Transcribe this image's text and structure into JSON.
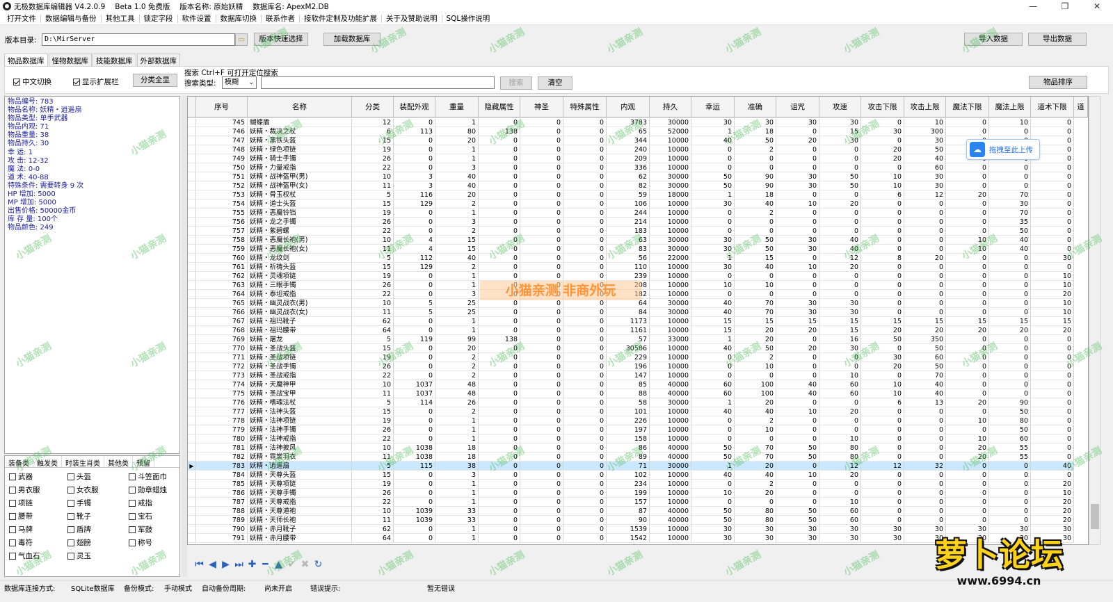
{
  "title": {
    "app": "无极数据库编辑器 V4.2.0.9",
    "beta": "Beta 1.0 免费版",
    "version": "版本名称: 原始妖精",
    "dbname": "数据库名: ApexM2.DB"
  },
  "window_buttons": {
    "min": "—",
    "max": "❐",
    "close": "✕"
  },
  "menu": [
    "打开文件",
    "数据编辑与备份",
    "其他工具",
    "锁定字段",
    "软件设置",
    "数据库切换",
    "联系作者",
    "接软件定制及功能扩展",
    "关于及赞助说明",
    "SQL操作说明"
  ],
  "toolbar": {
    "dir_label": "版本目录:",
    "dir_value": "D:\\MirServer",
    "quick_select": "版本快速选择",
    "load_db": "加载数据库",
    "import": "导入数据",
    "export": "导出数据"
  },
  "tabs": [
    {
      "label": "物品数据库",
      "active": true
    },
    {
      "label": "怪物数据库",
      "active": false
    },
    {
      "label": "技能数据库",
      "active": false
    },
    {
      "label": "外部数据库",
      "active": false
    }
  ],
  "filter": {
    "chinese_toggle": "中文切换",
    "show_ext": "显示扩展栏",
    "all_cats": "分类全显",
    "search_title": "搜索  Ctrl+F 可打开定位搜索",
    "search_type_label": "搜索类型:",
    "search_type": "模糊",
    "search_btn": "搜索",
    "clear_btn": "清空",
    "sort_btn": "物品排序"
  },
  "info": [
    "物品编号: 783",
    "物品名称: 妖精・逍遥扇",
    "物品类型: 单手武器",
    "物品内观: 71",
    "物品重量: 38",
    "物品持久: 30",
    "幸    运: 1",
    "攻    击: 12-32",
    "魔    法: 0-0",
    "道    术: 40-88",
    "特殊条件: 需要转身 9 次",
    "HP  增加: 5000",
    "MP  增加: 5000",
    "出售价格: 50000金币",
    "库 存 量: 100个",
    "物品颜色: 249"
  ],
  "cat_tabs": [
    "装备类",
    "触发类",
    "时装生肖类",
    "其他类",
    "预留"
  ],
  "categories": [
    "武器",
    "头盔",
    "斗笠面巾",
    "男衣服",
    "女衣服",
    "勋章蜡烛",
    "项链",
    "手镯",
    "戒指",
    "腰带",
    "靴子",
    "宝石",
    "马牌",
    "盾牌",
    "军鼓",
    "毒符",
    "翅膀",
    "称号",
    "气血石",
    "灵玉"
  ],
  "columns": [
    "序号",
    "名称",
    "分类",
    "装配外观",
    "重量",
    "隐藏属性",
    "神圣",
    "特殊属性",
    "内观",
    "持久",
    "幸运",
    "准确",
    "诅咒",
    "攻速",
    "攻击下限",
    "攻击上限",
    "魔法下限",
    "魔法上限",
    "道术下限",
    "道"
  ],
  "rows": [
    [
      "745",
      "蝴蝶盾",
      "12",
      "0",
      "1",
      "0",
      "0",
      "0",
      "3783",
      "30000",
      "30",
      "30",
      "30",
      "30",
      "0",
      "10",
      "0",
      "10",
      "0"
    ],
    [
      "746",
      "妖精・裁决之杖",
      "6",
      "113",
      "80",
      "138",
      "0",
      "0",
      "65",
      "52000",
      "1",
      "18",
      "0",
      "15",
      "30",
      "300",
      "0",
      "0",
      "0"
    ],
    [
      "747",
      "妖精・黑铁头盔",
      "15",
      "0",
      "20",
      "0",
      "0",
      "0",
      "344",
      "10000",
      "40",
      "50",
      "20",
      "30",
      "0",
      "30",
      "0",
      "0",
      "0"
    ],
    [
      "748",
      "妖精・绿色项链",
      "19",
      "0",
      "1",
      "0",
      "0",
      "0",
      "240",
      "10000",
      "0",
      "2",
      "0",
      "0",
      "20",
      "50",
      "0",
      "0",
      "0"
    ],
    [
      "749",
      "妖精・骑士手镯",
      "26",
      "0",
      "1",
      "0",
      "0",
      "0",
      "209",
      "10000",
      "0",
      "0",
      "0",
      "0",
      "20",
      "40",
      "0",
      "0",
      "0"
    ],
    [
      "750",
      "妖精・力量戒指",
      "22",
      "0",
      "3",
      "0",
      "0",
      "0",
      "336",
      "10000",
      "0",
      "0",
      "0",
      "0",
      "0",
      "60",
      "0",
      "0",
      "0"
    ],
    [
      "751",
      "妖精・战神盔甲(男)",
      "10",
      "3",
      "40",
      "0",
      "0",
      "0",
      "62",
      "30000",
      "50",
      "90",
      "30",
      "50",
      "10",
      "30",
      "0",
      "0",
      "0"
    ],
    [
      "752",
      "妖精・战神盔甲(女)",
      "11",
      "3",
      "40",
      "0",
      "0",
      "0",
      "82",
      "30000",
      "50",
      "90",
      "30",
      "50",
      "10",
      "30",
      "0",
      "0",
      "0"
    ],
    [
      "753",
      "妖精・骨玉权杖",
      "5",
      "116",
      "20",
      "0",
      "0",
      "0",
      "59",
      "18000",
      "1",
      "18",
      "0",
      "0",
      "6",
      "12",
      "20",
      "70",
      "0"
    ],
    [
      "754",
      "妖精・道士头盔",
      "15",
      "129",
      "2",
      "0",
      "0",
      "0",
      "106",
      "10000",
      "30",
      "40",
      "10",
      "20",
      "0",
      "0",
      "0",
      "30",
      "0"
    ],
    [
      "755",
      "妖精・恶魔铃铛",
      "19",
      "0",
      "1",
      "0",
      "0",
      "0",
      "244",
      "10000",
      "0",
      "2",
      "0",
      "0",
      "0",
      "0",
      "0",
      "70",
      "0"
    ],
    [
      "756",
      "妖精・龙之手镯",
      "26",
      "0",
      "3",
      "0",
      "0",
      "0",
      "214",
      "10000",
      "0",
      "0",
      "0",
      "0",
      "0",
      "0",
      "0",
      "35",
      "0"
    ],
    [
      "757",
      "妖精・紫碧螺",
      "22",
      "0",
      "2",
      "0",
      "0",
      "0",
      "183",
      "10000",
      "0",
      "0",
      "0",
      "0",
      "0",
      "0",
      "0",
      "50",
      "0"
    ],
    [
      "758",
      "妖精・恶魔长袍(男)",
      "10",
      "4",
      "15",
      "0",
      "0",
      "0",
      "63",
      "30000",
      "30",
      "50",
      "30",
      "40",
      "0",
      "0",
      "10",
      "40",
      "0"
    ],
    [
      "759",
      "妖精・恶魔长袍(女)",
      "11",
      "4",
      "15",
      "0",
      "0",
      "0",
      "83",
      "30000",
      "30",
      "50",
      "30",
      "40",
      "0",
      "0",
      "10",
      "40",
      "0"
    ],
    [
      "760",
      "妖精・龙纹剑",
      "5",
      "112",
      "40",
      "0",
      "0",
      "0",
      "56",
      "22000",
      "1",
      "15",
      "0",
      "12",
      "8",
      "20",
      "0",
      "0",
      "30"
    ],
    [
      "761",
      "妖精・祈祷头盔",
      "15",
      "129",
      "2",
      "0",
      "0",
      "0",
      "110",
      "10000",
      "30",
      "40",
      "10",
      "20",
      "0",
      "0",
      "0",
      "0",
      "0"
    ],
    [
      "762",
      "妖精・灵魂项链",
      "19",
      "0",
      "1",
      "0",
      "0",
      "0",
      "239",
      "10000",
      "0",
      "0",
      "0",
      "0",
      "0",
      "0",
      "0",
      "0",
      "10"
    ],
    [
      "763",
      "妖精・三眼手镯",
      "26",
      "0",
      "1",
      "0",
      "0",
      "0",
      "208",
      "10000",
      "10",
      "10",
      "0",
      "0",
      "0",
      "0",
      "0",
      "0",
      "10"
    ],
    [
      "764",
      "妖精・泰坦戒指",
      "22",
      "0",
      "3",
      "0",
      "0",
      "0",
      "182",
      "10000",
      "0",
      "0",
      "0",
      "0",
      "0",
      "0",
      "0",
      "0",
      "20"
    ],
    [
      "765",
      "妖精・幽灵战衣(男)",
      "10",
      "5",
      "25",
      "0",
      "0",
      "0",
      "64",
      "30000",
      "40",
      "70",
      "30",
      "30",
      "0",
      "0",
      "0",
      "0",
      "10"
    ],
    [
      "766",
      "妖精・幽灵战衣(女)",
      "11",
      "5",
      "25",
      "0",
      "0",
      "0",
      "84",
      "30000",
      "40",
      "70",
      "30",
      "30",
      "0",
      "0",
      "0",
      "0",
      "10"
    ],
    [
      "767",
      "妖精・祖玛靴子",
      "62",
      "0",
      "1",
      "0",
      "0",
      "0",
      "1173",
      "10000",
      "15",
      "15",
      "15",
      "15",
      "15",
      "15",
      "15",
      "15",
      "15"
    ],
    [
      "768",
      "妖精・祖玛腰带",
      "64",
      "0",
      "1",
      "0",
      "0",
      "0",
      "1161",
      "10000",
      "15",
      "20",
      "20",
      "15",
      "20",
      "20",
      "20",
      "20",
      "20"
    ],
    [
      "769",
      "妖精・屠龙",
      "5",
      "119",
      "99",
      "138",
      "0",
      "0",
      "57",
      "33000",
      "1",
      "20",
      "0",
      "16",
      "50",
      "350",
      "0",
      "0",
      "0"
    ],
    [
      "770",
      "妖精・圣战头盔",
      "15",
      "0",
      "20",
      "0",
      "0",
      "0",
      "30586",
      "10000",
      "40",
      "50",
      "20",
      "30",
      "0",
      "50",
      "0",
      "0",
      "0"
    ],
    [
      "771",
      "妖精・圣战项链",
      "19",
      "0",
      "2",
      "0",
      "0",
      "0",
      "229",
      "10000",
      "0",
      "2",
      "0",
      "0",
      "30",
      "60",
      "0",
      "0",
      "0"
    ],
    [
      "772",
      "妖精・圣战手镯",
      "26",
      "0",
      "2",
      "0",
      "0",
      "0",
      "196",
      "10000",
      "0",
      "10",
      "0",
      "0",
      "20",
      "50",
      "0",
      "0",
      "0"
    ],
    [
      "773",
      "妖精・圣战戒指",
      "22",
      "0",
      "2",
      "0",
      "0",
      "0",
      "147",
      "10000",
      "0",
      "0",
      "0",
      "10",
      "0",
      "70",
      "0",
      "0",
      "0"
    ],
    [
      "774",
      "妖精・天魔神甲",
      "10",
      "1037",
      "48",
      "0",
      "0",
      "0",
      "85",
      "40000",
      "60",
      "100",
      "40",
      "60",
      "10",
      "40",
      "0",
      "0",
      "0"
    ],
    [
      "775",
      "妖精・圣战宝甲",
      "11",
      "1037",
      "48",
      "0",
      "0",
      "0",
      "88",
      "40000",
      "60",
      "100",
      "40",
      "60",
      "10",
      "40",
      "0",
      "0",
      "0"
    ],
    [
      "776",
      "妖精・嗜魂法杖",
      "5",
      "114",
      "26",
      "0",
      "0",
      "0",
      "58",
      "30000",
      "1",
      "20",
      "0",
      "0",
      "6",
      "13",
      "20",
      "90",
      "0"
    ],
    [
      "777",
      "妖精・法神头盔",
      "15",
      "0",
      "2",
      "0",
      "0",
      "0",
      "101",
      "10000",
      "40",
      "40",
      "10",
      "20",
      "0",
      "0",
      "0",
      "50",
      "0"
    ],
    [
      "778",
      "妖精・法神项链",
      "19",
      "0",
      "1",
      "0",
      "0",
      "0",
      "226",
      "10000",
      "0",
      "2",
      "0",
      "0",
      "0",
      "0",
      "10",
      "80",
      "0"
    ],
    [
      "779",
      "妖精・法神手镯",
      "26",
      "0",
      "1",
      "0",
      "0",
      "0",
      "197",
      "10000",
      "0",
      "10",
      "0",
      "0",
      "0",
      "0",
      "0",
      "50",
      "0"
    ],
    [
      "780",
      "妖精・法神戒指",
      "22",
      "0",
      "1",
      "0",
      "0",
      "0",
      "158",
      "10000",
      "0",
      "0",
      "0",
      "10",
      "0",
      "0",
      "10",
      "60",
      "0"
    ],
    [
      "781",
      "妖精・法神披风",
      "10",
      "1038",
      "18",
      "0",
      "0",
      "0",
      "86",
      "40000",
      "50",
      "70",
      "50",
      "80",
      "0",
      "0",
      "20",
      "55",
      "0"
    ],
    [
      "782",
      "妖精・霓裳羽衣",
      "11",
      "1038",
      "18",
      "0",
      "0",
      "0",
      "89",
      "40000",
      "50",
      "70",
      "50",
      "80",
      "0",
      "0",
      "20",
      "55",
      "0"
    ],
    [
      "783",
      "妖精・逍遥扇",
      "5",
      "115",
      "38",
      "0",
      "0",
      "0",
      "71",
      "30000",
      "1",
      "20",
      "0",
      "12",
      "12",
      "32",
      "0",
      "0",
      "40"
    ],
    [
      "784",
      "妖精・天尊头盔",
      "15",
      "0",
      "3",
      "0",
      "0",
      "0",
      "102",
      "10000",
      "40",
      "40",
      "10",
      "20",
      "0",
      "0",
      "0",
      "0",
      "0"
    ],
    [
      "785",
      "妖精・天尊项链",
      "19",
      "0",
      "1",
      "0",
      "0",
      "0",
      "234",
      "10000",
      "0",
      "2",
      "0",
      "0",
      "0",
      "0",
      "0",
      "0",
      "20"
    ],
    [
      "786",
      "妖精・天尊手镯",
      "26",
      "0",
      "1",
      "0",
      "0",
      "0",
      "199",
      "10000",
      "10",
      "20",
      "0",
      "0",
      "0",
      "0",
      "0",
      "0",
      "10"
    ],
    [
      "787",
      "妖精・天尊戒指",
      "22",
      "0",
      "1",
      "0",
      "0",
      "0",
      "157",
      "10000",
      "0",
      "0",
      "0",
      "10",
      "0",
      "0",
      "0",
      "0",
      "20"
    ],
    [
      "788",
      "妖精・天尊道袍",
      "10",
      "1039",
      "33",
      "0",
      "0",
      "0",
      "87",
      "40000",
      "50",
      "80",
      "50",
      "60",
      "0",
      "0",
      "0",
      "0",
      "20"
    ],
    [
      "789",
      "妖精・天师长袍",
      "11",
      "1039",
      "33",
      "0",
      "0",
      "0",
      "90",
      "40000",
      "50",
      "80",
      "50",
      "60",
      "0",
      "0",
      "0",
      "0",
      "20"
    ],
    [
      "790",
      "妖精・赤月靴子",
      "62",
      "0",
      "1",
      "0",
      "0",
      "0",
      "1539",
      "10000",
      "30",
      "30",
      "30",
      "30",
      "30",
      "30",
      "30",
      "30",
      "30"
    ],
    [
      "791",
      "妖精・赤月腰带",
      "64",
      "0",
      "1",
      "0",
      "0",
      "0",
      "1542",
      "10000",
      "30",
      "30",
      "30",
      "30",
      "30",
      "30",
      "30",
      "30",
      "30"
    ]
  ],
  "selected_row": "783",
  "nav_icons": [
    "first-icon",
    "prev-icon",
    "next-icon",
    "last-icon",
    "add-icon",
    "delete-icon",
    "up-icon",
    "confirm-icon",
    "cancel-icon",
    "refresh-icon"
  ],
  "nav_glyphs": [
    "⏮",
    "◀",
    "▶",
    "⏭",
    "✚",
    "━",
    "▲",
    "✔",
    "✖",
    "↻"
  ],
  "status": {
    "conn_label": "数据库连接方式:",
    "conn": "SQLite数据库",
    "backup_label": "备份模式:",
    "backup": "手动模式",
    "period_label": "自动备份周期:",
    "period": "尚未开启",
    "err_label": "错误提示:",
    "err": "暂无错误"
  },
  "upload": "拖拽至此上传",
  "watermark": "小猫亲测",
  "center_watermark": "小猫亲测 非商外玩",
  "logo": {
    "text": "萝卜论坛",
    "url": "www.6994.cn"
  }
}
